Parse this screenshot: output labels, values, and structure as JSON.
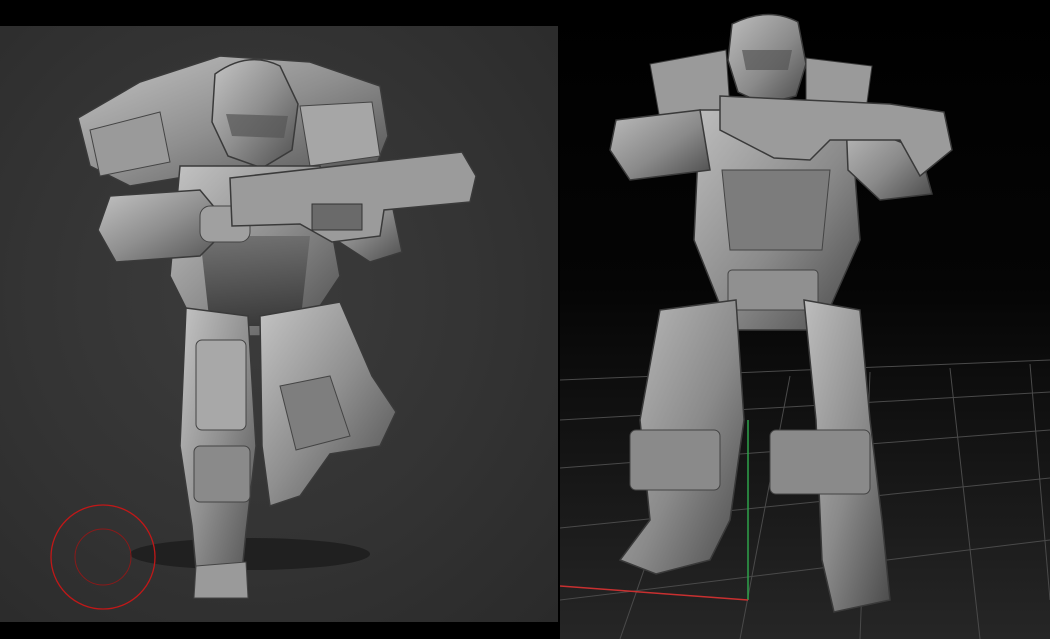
{
  "viewports": {
    "left": {
      "name": "zbrush-sculpt-viewport",
      "brush_cursor_color": "#c01818"
    },
    "right": {
      "name": "3d-scene-viewport",
      "axis_colors": {
        "x": "#c83030",
        "y": "#2ea24a"
      }
    }
  },
  "colors": {
    "clay": "#8e8e8e",
    "clay_dark": "#5e5e5e",
    "clay_light": "#b4b4b4",
    "grid": "#5a5a5a"
  }
}
